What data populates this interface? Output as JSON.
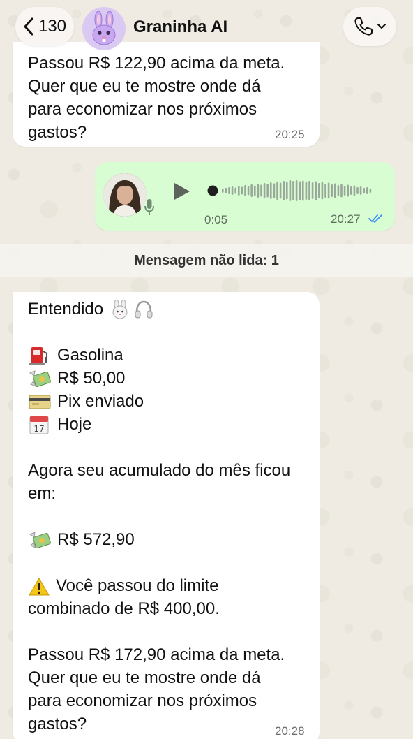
{
  "header": {
    "back_count": "130",
    "contact_name": "Graninha AI",
    "avatar_icon": "bunny-icon",
    "call_icon": "phone-icon"
  },
  "messages": [
    {
      "direction": "incoming",
      "text": "Passou R$ 122,90 acima da meta.\nQuer que eu te mostre onde dá\npara economizar nos próximos\ngastos?",
      "time": "20:25"
    },
    {
      "direction": "outgoing",
      "type": "voice",
      "duration": "0:05",
      "time": "20:27",
      "status": "read"
    }
  ],
  "unread_banner": "Mensagem não lida: 1",
  "reply": {
    "greeting": "Entendido",
    "greeting_emojis": [
      "rabbit-face",
      "headphone"
    ],
    "details": [
      {
        "icon": "fuel-pump-icon",
        "text": "Gasolina"
      },
      {
        "icon": "money-with-wings-icon",
        "text": "R$ 50,00"
      },
      {
        "icon": "credit-card-icon",
        "text": "Pix enviado"
      },
      {
        "icon": "calendar-icon",
        "text": "Hoje"
      }
    ],
    "accumulated_label": "Agora seu acumulado do mês ficou\nem:",
    "accumulated_icon": "money-with-wings-icon",
    "accumulated_value": "R$ 572,90",
    "warning_icon": "warning-icon",
    "warning_text": "Você passou do limite\ncombinado de R$ 400,00.",
    "closing_text": "Passou R$ 172,90 acima da meta.\nQuer que eu te mostre onde dá\npara economizar nos próximos\ngastos?",
    "time": "20:28"
  },
  "colors": {
    "outgoing_bubble": "#d9fdd3",
    "read_ticks": "#3e8ef7"
  }
}
